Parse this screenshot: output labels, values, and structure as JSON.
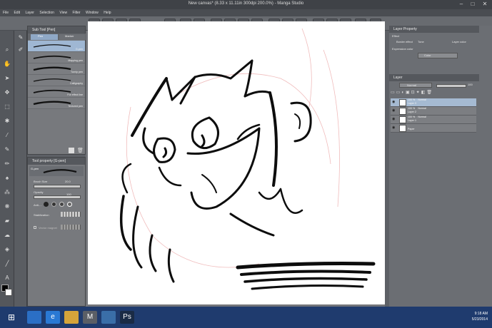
{
  "window": {
    "title": "New canvas* (8.33 x 11.11in 300dpi 200.0%) - Manga Studio",
    "minimize": "–",
    "maximize": "□",
    "close": "✕"
  },
  "menu": [
    "File",
    "Edit",
    "Layer",
    "Selection",
    "View",
    "Filter",
    "Window",
    "Help"
  ],
  "subtool": {
    "header": "Sub Tool [Pen]",
    "tabs": [
      "Pen",
      "Marker"
    ],
    "brushes": [
      {
        "label": "G-pen",
        "selected": true
      },
      {
        "label": "Mapping pen",
        "selected": false
      },
      {
        "label": "Turnip pen",
        "selected": false
      },
      {
        "label": "Calligraphy",
        "selected": false
      },
      {
        "label": "For effect line",
        "selected": false
      },
      {
        "label": "Textured pen",
        "selected": false
      }
    ]
  },
  "tool_property": {
    "header": "Tool property [G-pen]",
    "brush_name": "G-pen",
    "brush_size_label": "Brush Size",
    "brush_size_value": "20.0",
    "opacity_label": "Opacity",
    "opacity_value": "100",
    "anti_label": "Anti-...",
    "stabilization_label": "Stabilization",
    "vector_magnet_label": "Vector magnet"
  },
  "layer_property": {
    "header": "Layer Property",
    "effect_label": "Effect",
    "border_effect": "Border effect",
    "tone": "Tone",
    "layer_color": "Layer color",
    "expression_color_label": "Expression color",
    "expression_color_value": "Color"
  },
  "layer_panel": {
    "header": "Layer",
    "blend_mode": "Normal",
    "opacity": "100",
    "layers": [
      {
        "pct": "100 %",
        "mode": "Normal",
        "name": "Layer 3",
        "selected": true
      },
      {
        "pct": "100 %",
        "mode": "Normal",
        "name": "Layer 2",
        "selected": false
      },
      {
        "pct": "100 %",
        "mode": "Normal",
        "name": "Layer 1",
        "selected": false
      },
      {
        "pct": "",
        "mode": "",
        "name": "Paper",
        "selected": false
      }
    ]
  },
  "taskbar": {
    "time": "9:18 AM",
    "date": "5/23/2014",
    "apps": [
      "windows-store-icon",
      "internet-explorer-icon",
      "file-explorer-icon",
      "manga-studio-icon",
      "notepad-icon",
      "photoshop-icon"
    ],
    "app_labels": [
      "",
      "e",
      "",
      "M",
      "",
      "Ps"
    ]
  },
  "colors": {
    "titlebar": "#3f4247",
    "panel": "#77797d",
    "selection": "#9fb7d3",
    "taskbar": "#1f3b6e",
    "paper": "#ffffff"
  }
}
